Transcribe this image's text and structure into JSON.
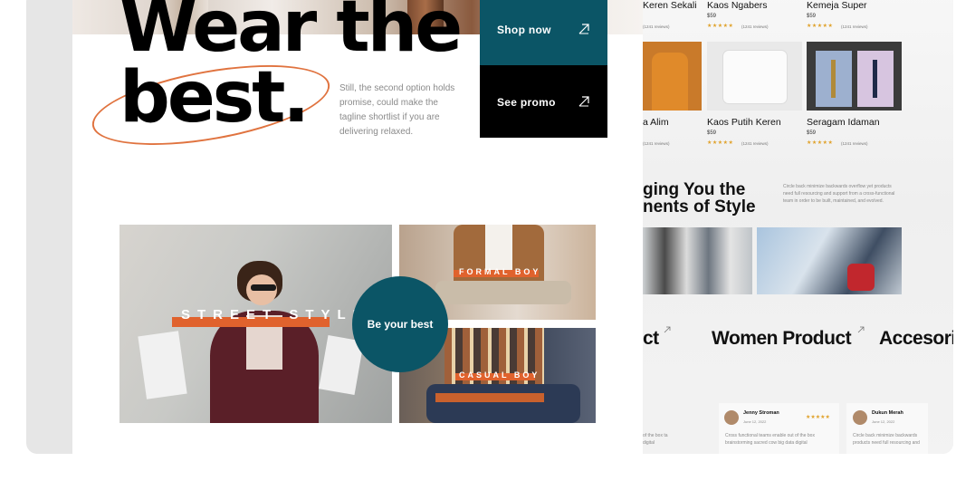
{
  "hero": {
    "headline_line1": "Wear the",
    "headline_line2": "best.",
    "tagline": "Still, the second option holds promise, could make the tagline shortlist if you are delivering relaxed."
  },
  "cta": {
    "shop_now": "Shop now",
    "see_promo": "See promo",
    "be_your_best": "Be your best"
  },
  "collage": {
    "street_style": "STREET STYLE",
    "formal_boy": "FORMAL BOY",
    "casual_boy": "CASUAL BOY"
  },
  "products_row1": [
    {
      "name": "Keren Sekali",
      "price": "",
      "stars": "★★★★★",
      "reviews": "(1241 reviews)"
    },
    {
      "name": "Kaos Ngabers",
      "price": "$59",
      "stars": "★★★★★",
      "reviews": "(1241 reviews)"
    },
    {
      "name": "Kemeja Super",
      "price": "$59",
      "stars": "★★★★★",
      "reviews": "(1241 reviews)"
    }
  ],
  "products_row2": [
    {
      "name": "a Alim",
      "price": "",
      "stars": "",
      "reviews": "(1241 reviews)"
    },
    {
      "name": "Kaos Putih Keren",
      "price": "$59",
      "stars": "★★★★★",
      "reviews": "(1241 reviews)"
    },
    {
      "name": "Seragam Idaman",
      "price": "$59",
      "stars": "★★★★★",
      "reviews": "(1241 reviews)"
    }
  ],
  "style_section": {
    "title_line1": "ging You the",
    "title_line2": "nents of Style",
    "description": "Circle back minimize backwards overflow yet products need full resourcing and support from a cross-functional team in order to be built, maintained, and evolved."
  },
  "categories": {
    "first": "ct",
    "second": "Women Product",
    "third": "Accesori"
  },
  "testimonials": [
    {
      "name": "Jenny Stroman",
      "date": "June 12, 2022",
      "stars": "★★★★★",
      "text": "Cross functional teams enable out of the box brainstorming sacred cow big data digital"
    },
    {
      "name": "Dukun Merah",
      "date": "June 12, 2022",
      "stars": "",
      "text": "Circle back minimize backwards products need full resourcing and"
    }
  ],
  "testimonial_partial_text": "of the box ta digital",
  "colors": {
    "teal": "#0b5566",
    "orange": "#e0622d",
    "oval": "#e0733f",
    "star": "#e0a22b"
  }
}
